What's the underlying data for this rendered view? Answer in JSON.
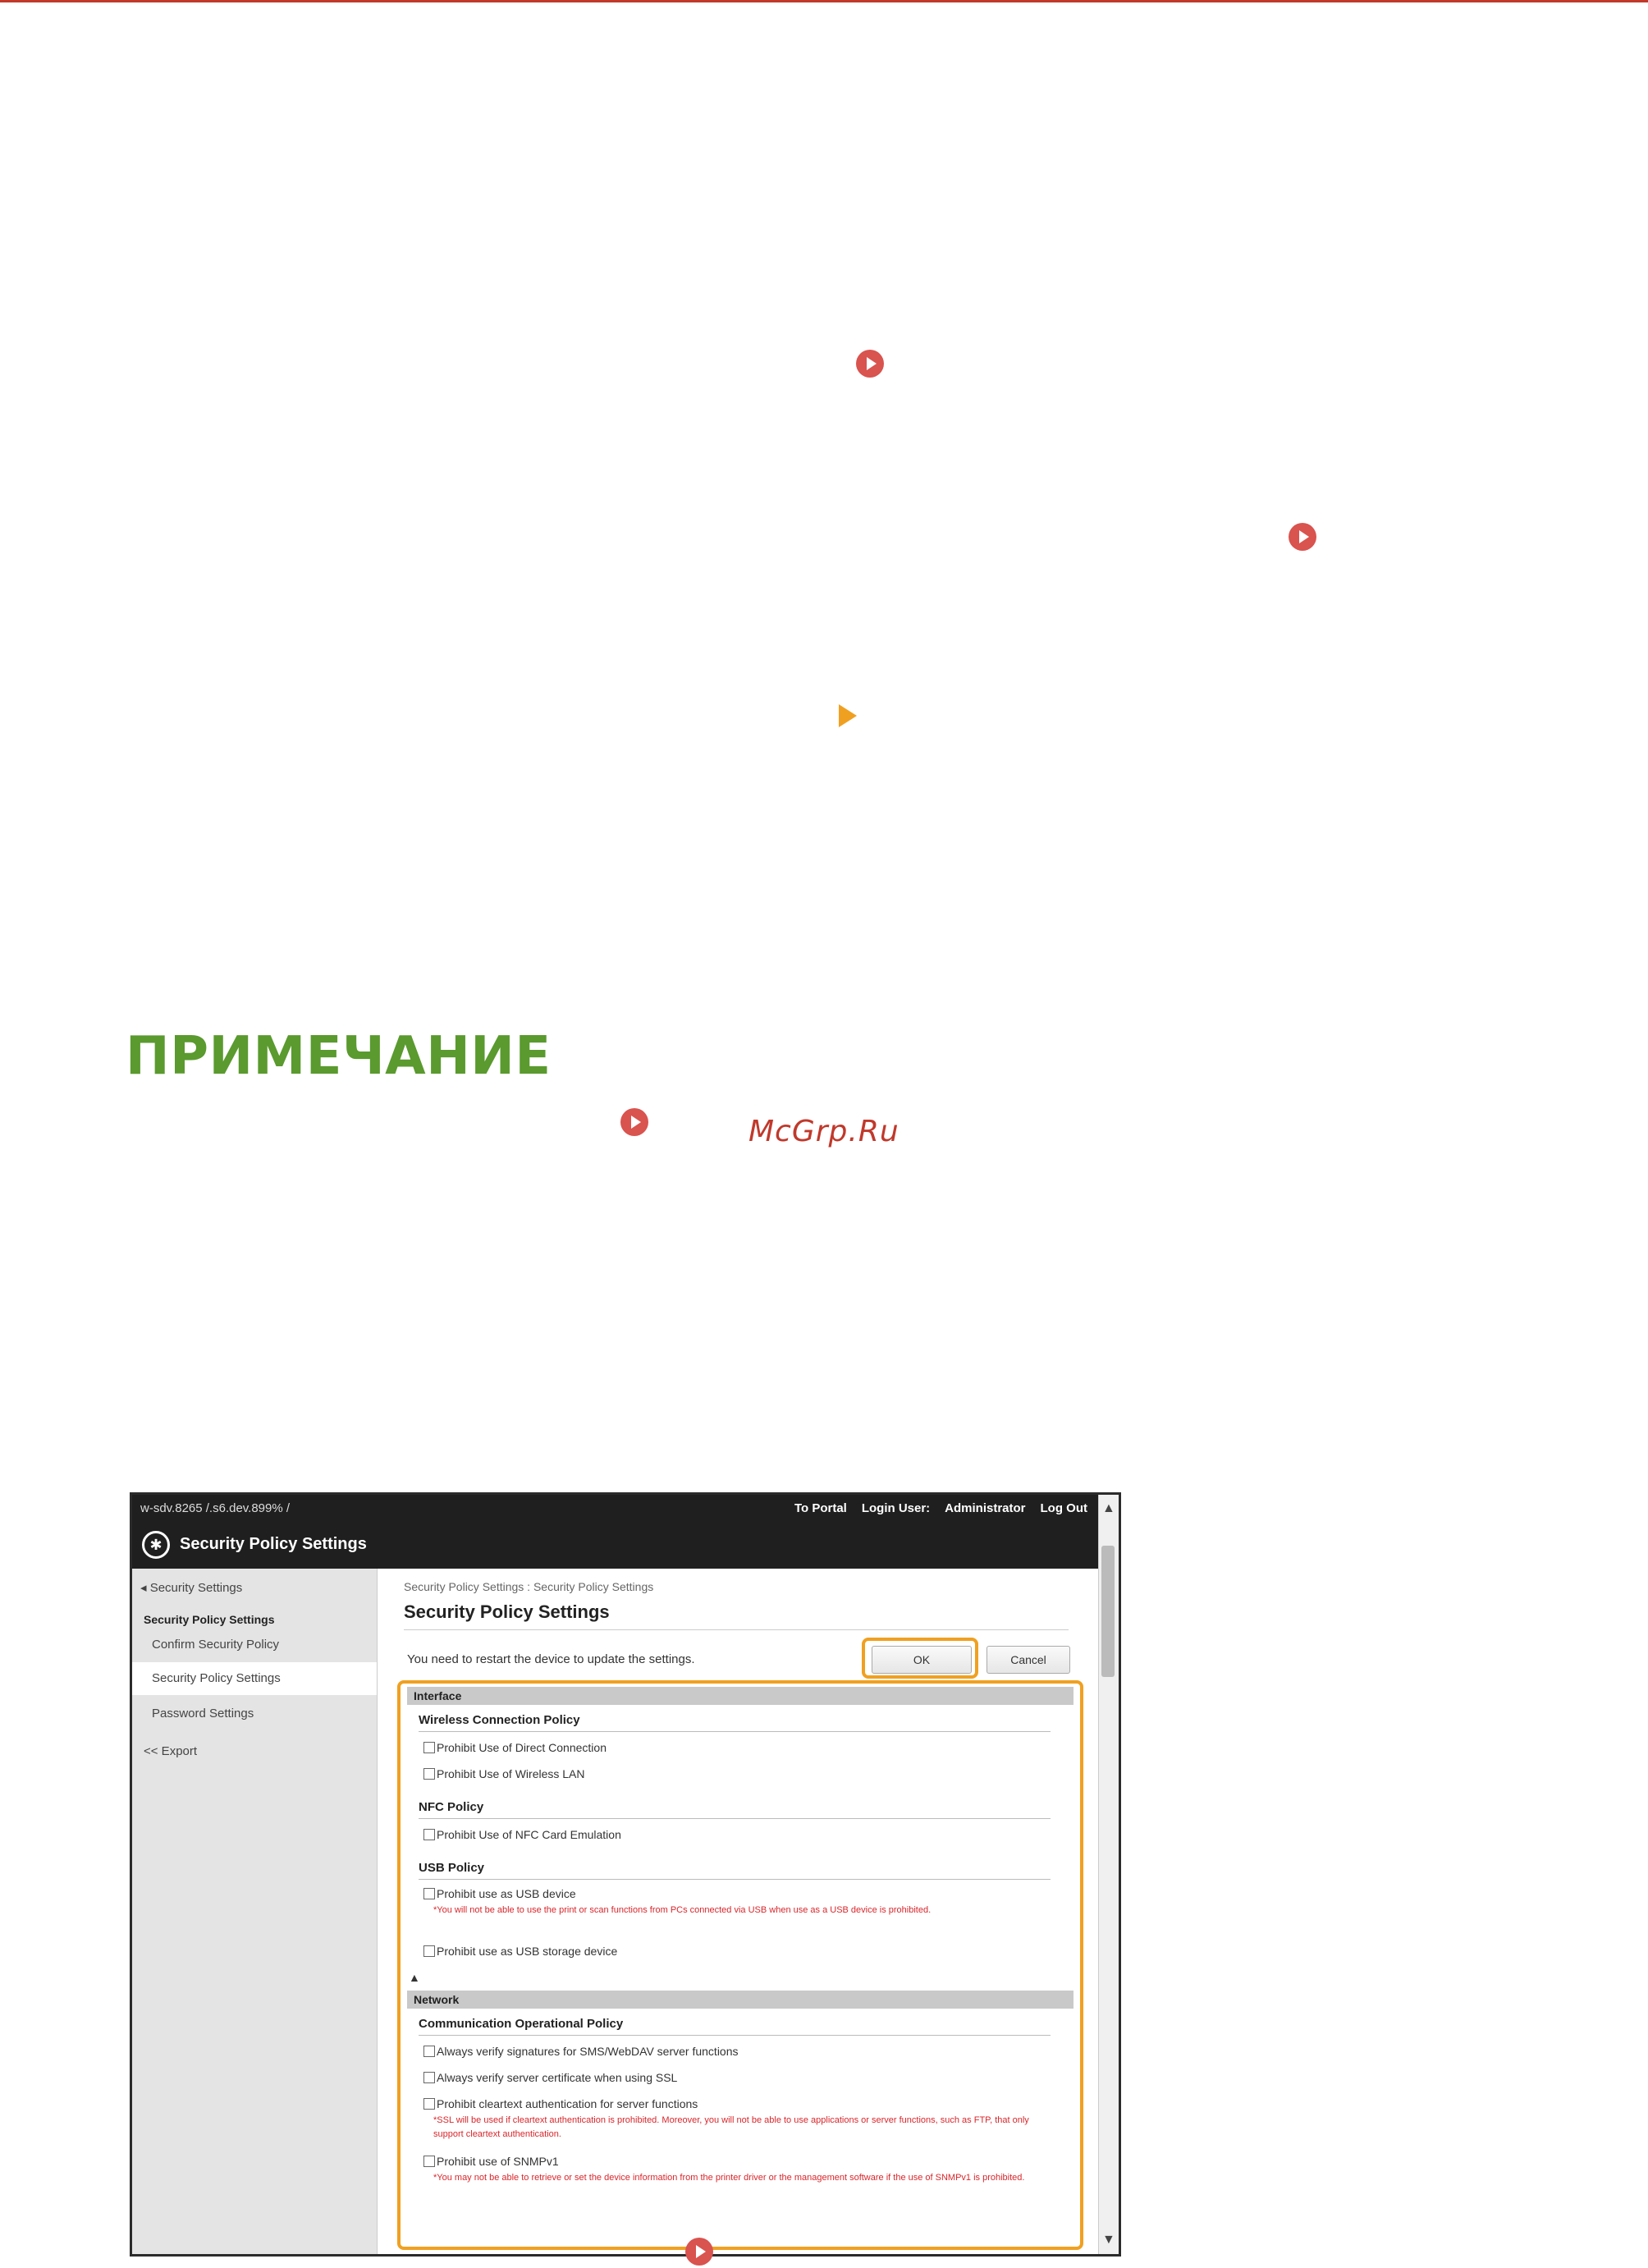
{
  "note_heading": "ПРИМЕЧАНИЕ",
  "watermark": "McGrp.Ru",
  "screenshot": {
    "host": "w-sdv.8265 /.s6.dev.899% /",
    "top_links": [
      "To Portal",
      "Login User:",
      "Administrator",
      "Log Out"
    ],
    "window_title": "Security Policy Settings",
    "sidebar": {
      "back": "Security Settings",
      "heading": "Security Policy Settings",
      "items": [
        "Confirm Security Policy",
        "Security Policy Settings",
        "Password Settings"
      ],
      "export": "<< Export"
    },
    "breadcrumb": "Security Policy Settings : Security Policy Settings",
    "page_title": "Security Policy Settings",
    "restart_message": "You need to restart the device to update the settings.",
    "ok_label": "OK",
    "cancel_label": "Cancel",
    "interface": {
      "title": "Interface",
      "wireless_title": "Wireless Connection Policy",
      "wireless_opts": [
        "Prohibit Use of Direct Connection",
        "Prohibit Use of Wireless LAN"
      ],
      "nfc_title": "NFC Policy",
      "nfc_opt": "Prohibit Use of NFC Card Emulation",
      "usb_title": "USB Policy",
      "usb_opt1": "Prohibit use as USB device",
      "usb_note": "*You will not be able to use the print or scan functions from PCs connected via USB when use as a USB device is prohibited.",
      "usb_opt2": "Prohibit use as USB storage device"
    },
    "network": {
      "title": "Network",
      "comm_title": "Communication Operational Policy",
      "opt1": "Always verify signatures for SMS/WebDAV server functions",
      "opt2": "Always verify server certificate when using SSL",
      "opt3": "Prohibit cleartext authentication for server functions",
      "note3": "*SSL will be used if cleartext authentication is prohibited. Moreover, you will not be able to use applications or server functions, such as FTP, that only support cleartext authentication.",
      "opt4": "Prohibit use of SNMPv1",
      "note4": "*You may not be able to retrieve or set the device information from the printer driver or the management software if the use of SNMPv1 is prohibited."
    }
  }
}
